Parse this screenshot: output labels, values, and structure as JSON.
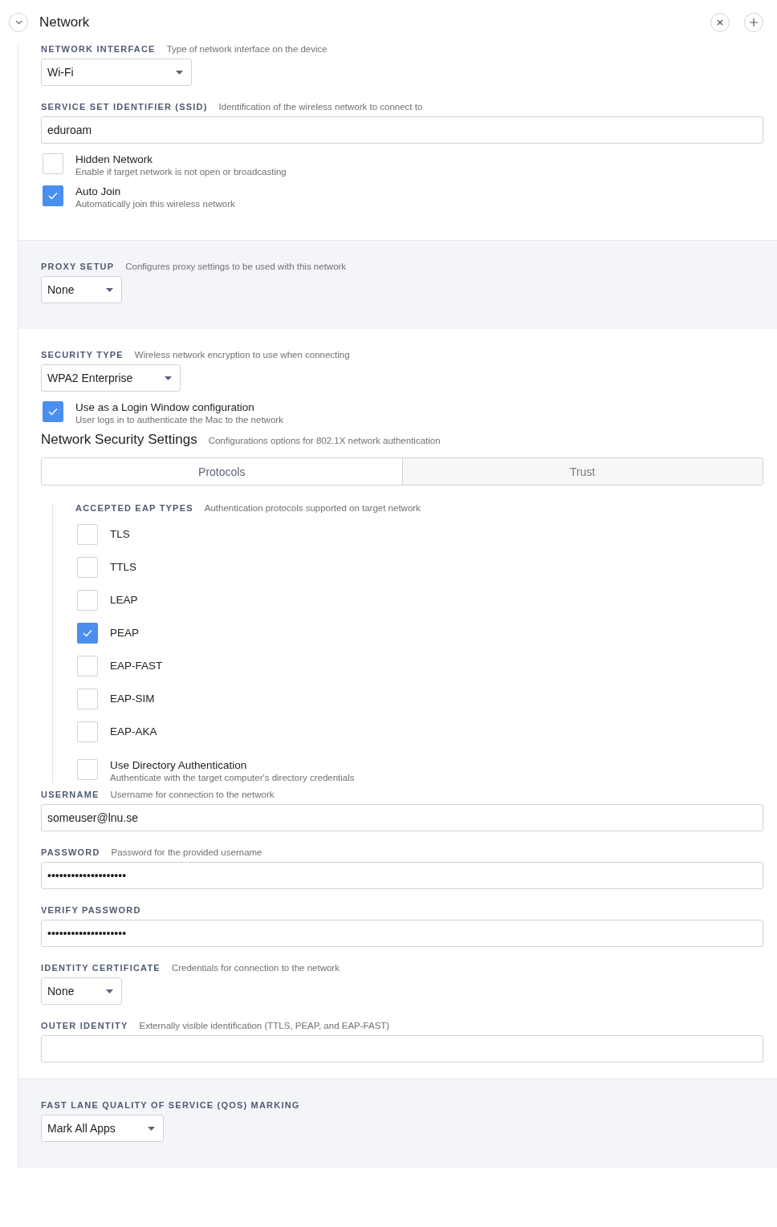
{
  "header": {
    "title": "Network"
  },
  "sections": [
    {
      "kind": "plain",
      "items": [
        {
          "kind": "select",
          "label": "NETWORK INTERFACE",
          "hint": "Type of network interface on the device",
          "value": "Wi-Fi"
        },
        {
          "kind": "text",
          "label": "SERVICE SET IDENTIFIER (SSID)",
          "hint": "Identification of the wireless network to connect to",
          "value": "eduroam"
        },
        {
          "kind": "checkbox",
          "title": "Hidden Network",
          "description": "Enable if target network is not open or broadcasting",
          "checked": false
        },
        {
          "kind": "checkbox",
          "title": "Auto Join",
          "description": "Automatically join this wireless network",
          "checked": true
        }
      ]
    },
    {
      "kind": "shaded",
      "items": [
        {
          "kind": "select",
          "label": "PROXY SETUP",
          "hint": "Configures proxy settings to be used with this network",
          "value": "None"
        }
      ]
    },
    {
      "kind": "plain",
      "items": [
        {
          "kind": "select",
          "label": "SECURITY TYPE",
          "hint": "Wireless network encryption to use when connecting",
          "value": "WPA2 Enterprise"
        },
        {
          "kind": "checkbox",
          "title": "Use as a Login Window configuration",
          "description": "User logs in to authenticate the Mac to the network",
          "checked": true
        },
        {
          "kind": "heading",
          "title": "Network Security Settings",
          "hint": "Configurations options for 802.1X network authentication"
        },
        {
          "kind": "tabs",
          "tabs": [
            {
              "label": "Protocols",
              "selected": true
            },
            {
              "label": "Trust",
              "selected": false
            }
          ],
          "panel": {
            "label": "ACCEPTED EAP TYPES",
            "hint": "Authentication protocols supported on target network",
            "options": [
              {
                "label": "TLS",
                "checked": false
              },
              {
                "label": "TTLS",
                "checked": false
              },
              {
                "label": "LEAP",
                "checked": false
              },
              {
                "label": "PEAP",
                "checked": true
              },
              {
                "label": "EAP-FAST",
                "checked": false
              },
              {
                "label": "EAP-SIM",
                "checked": false
              },
              {
                "label": "EAP-AKA",
                "checked": false
              }
            ],
            "extra": {
              "title": "Use Directory Authentication",
              "description": "Authenticate with the target computer's directory credentials",
              "checked": false
            }
          }
        },
        {
          "kind": "text",
          "label": "USERNAME",
          "hint": "Username for connection to the network",
          "value": "someuser@lnu.se"
        },
        {
          "kind": "text",
          "label": "PASSWORD",
          "hint": "Password for the provided username",
          "value": "••••••••••••••••••••"
        },
        {
          "kind": "text",
          "label": "VERIFY PASSWORD",
          "value": "••••••••••••••••••••"
        },
        {
          "kind": "select",
          "label": "IDENTITY CERTIFICATE",
          "hint": "Credentials for connection to the network",
          "value": "None"
        },
        {
          "kind": "text",
          "label": "OUTER IDENTITY",
          "hint": "Externally visible identification (TTLS, PEAP, and EAP-FAST)"
        }
      ]
    },
    {
      "kind": "shaded",
      "items": [
        {
          "kind": "select",
          "label": "FAST LANE QUALITY OF SERVICE (QOS) MARKING",
          "value": "Mark All Apps"
        }
      ]
    }
  ]
}
